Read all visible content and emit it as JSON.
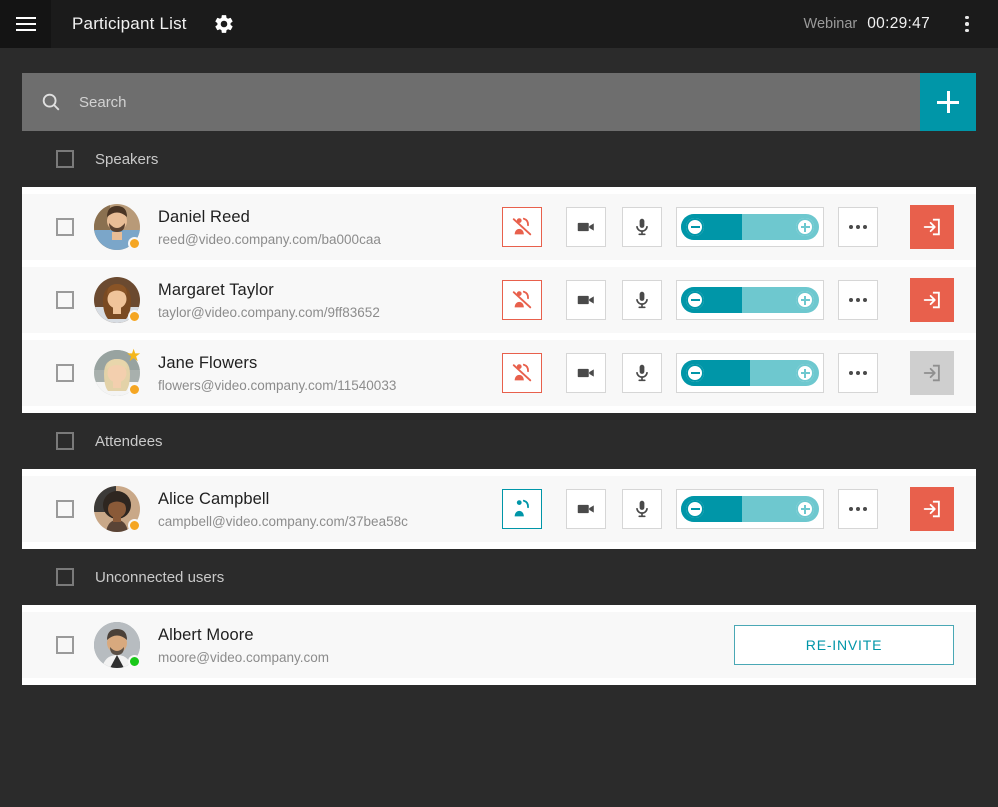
{
  "header": {
    "menu_icon": "hamburger-icon",
    "title": "Participant List",
    "settings_icon": "gear-icon",
    "mode_label": "Webinar",
    "timer": "00:29:47",
    "overflow_icon": "kebab-menu-icon"
  },
  "search": {
    "icon": "search-icon",
    "placeholder": "Search",
    "value": "",
    "add_icon": "plus-icon"
  },
  "colors": {
    "accent_teal": "#0096a8",
    "danger_red": "#e8604c",
    "status_away": "#f5a623",
    "status_online": "#19c819",
    "star_gold": "#f5b71a",
    "topbar_bg": "#1b1b1b",
    "page_bg": "#2b2b2b"
  },
  "sections": [
    {
      "title": "Speakers",
      "checkbox_checked": false,
      "participants": [
        {
          "name": "Daniel Reed",
          "email": "reed@video.company.com/ba000caa",
          "status": "away",
          "moderator": false,
          "checkbox_checked": false,
          "hand_icon": "raise-hand-off-icon",
          "hand_state": "off",
          "camera_icon": "video-camera-icon",
          "mic_icon": "microphone-icon",
          "volume_icon_minus": "volume-minus-icon",
          "volume_icon_plus": "volume-plus-icon",
          "volume_level": 44,
          "more_icon": "more-options-icon",
          "exit_icon": "remove-participant-icon",
          "exit_enabled": true,
          "avatar_type": "photo-male-beard"
        },
        {
          "name": "Margaret Taylor",
          "email": "taylor@video.company.com/9ff83652",
          "status": "away",
          "moderator": false,
          "checkbox_checked": false,
          "hand_icon": "raise-hand-off-icon",
          "hand_state": "off",
          "camera_icon": "video-camera-icon",
          "mic_icon": "microphone-icon",
          "volume_icon_minus": "volume-minus-icon",
          "volume_icon_plus": "volume-plus-icon",
          "volume_level": 44,
          "more_icon": "more-options-icon",
          "exit_icon": "remove-participant-icon",
          "exit_enabled": true,
          "avatar_type": "photo-female-curly"
        },
        {
          "name": "Jane Flowers",
          "email": "flowers@video.company.com/11540033",
          "status": "away",
          "moderator": true,
          "checkbox_checked": false,
          "hand_icon": "raise-hand-off-icon",
          "hand_state": "off",
          "camera_icon": "video-camera-icon",
          "mic_icon": "microphone-icon",
          "volume_icon_minus": "volume-minus-icon",
          "volume_icon_plus": "volume-plus-icon",
          "volume_level": 50,
          "more_icon": "more-options-icon",
          "exit_icon": "remove-participant-icon",
          "exit_enabled": false,
          "avatar_type": "photo-female-blonde"
        }
      ]
    },
    {
      "title": "Attendees",
      "checkbox_checked": false,
      "participants": [
        {
          "name": "Alice Campbell",
          "email": "campbell@video.company.com/37bea58c",
          "status": "away",
          "moderator": false,
          "checkbox_checked": false,
          "hand_icon": "raise-hand-icon",
          "hand_state": "on",
          "camera_icon": "video-camera-icon",
          "mic_icon": "microphone-icon",
          "volume_icon_minus": "volume-minus-icon",
          "volume_icon_plus": "volume-plus-icon",
          "volume_level": 44,
          "more_icon": "more-options-icon",
          "exit_icon": "remove-participant-icon",
          "exit_enabled": true,
          "avatar_type": "photo-female-afro"
        }
      ]
    },
    {
      "title": "Unconnected users",
      "checkbox_checked": false,
      "participants": [
        {
          "name": "Albert Moore",
          "email": "moore@video.company.com",
          "status": "online",
          "moderator": false,
          "checkbox_checked": false,
          "reinvite_label": "RE-INVITE",
          "avatar_type": "photo-male-suit"
        }
      ]
    }
  ]
}
